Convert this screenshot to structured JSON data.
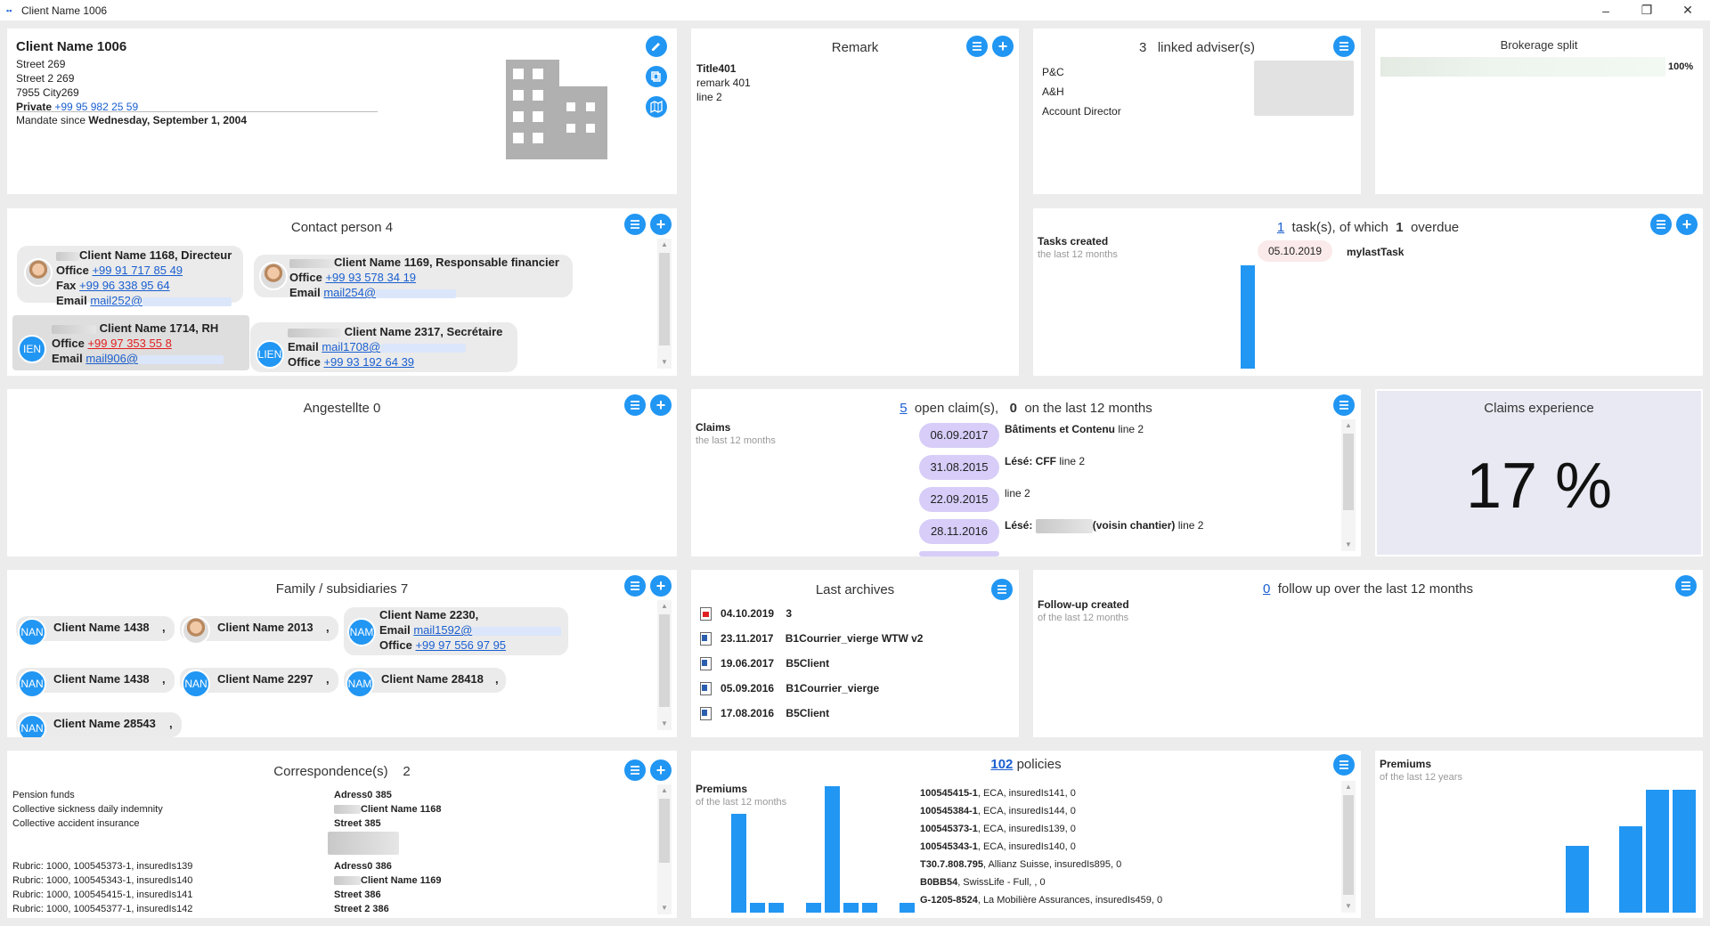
{
  "window": {
    "title": "Client Name 1006",
    "min": "–",
    "max": "❐",
    "close": "✕"
  },
  "client": {
    "name": "Client Name 1006",
    "street": "Street 269",
    "street2": "Street 2 269",
    "city": "7955 City269",
    "phone_label": "Private",
    "phone": "+99 95 982 25 59",
    "mandate_label": "Mandate since",
    "mandate_date": "Wednesday, September 1, 2004"
  },
  "remark": {
    "title": "Remark",
    "heading": "Title401",
    "line1": "remark 401",
    "line2": "line 2"
  },
  "advisers": {
    "count": "3",
    "title": "linked adviser(s)",
    "roles": [
      "P&C",
      "A&H",
      "Account Director"
    ]
  },
  "brokerage": {
    "title": "Brokerage split",
    "percent": "100%",
    "fill": 1.0
  },
  "contacts": {
    "title": "Contact person 4",
    "persons": [
      {
        "name": "Client Name 1168",
        "role": ", Directeur",
        "office_label": "Office",
        "office": "+99 91 717 85 49",
        "fax_label": "Fax",
        "fax": "+99 96 338 95 64",
        "email_label": "Email",
        "email": "mail252@"
      },
      {
        "name": "Client Name 1169",
        "role": ", Responsable financier",
        "office_label": "Office",
        "office": "+99 93 578 34 19",
        "email_label": "Email",
        "email": "mail254@"
      },
      {
        "name": "Client Name 1714",
        "role": ", RH",
        "office_label": "Office",
        "office": "+99 97 353 55 8",
        "email_label": "Email",
        "email": "mail906@",
        "avatar": "IEN"
      },
      {
        "name": "Client Name 2317",
        "role": ", Secrétaire",
        "email_label": "Email",
        "email": "mail1708@",
        "office_label": "Office",
        "office": "+99 93 192 64 39",
        "avatar": "LIEN"
      }
    ]
  },
  "tasks": {
    "count": "1",
    "middle": "task(s), of which",
    "overdue_count": "1",
    "overdue": "overdue",
    "chart_title": "Tasks created",
    "chart_sub": "the last 12 months",
    "date": "05.10.2019",
    "task": "mylastTask"
  },
  "angestellte": {
    "title": "Angestellte 0"
  },
  "claims": {
    "open_count": "5",
    "open_label": "open claim(s),",
    "recent_count": "0",
    "recent_label": "on the last 12 months",
    "chart_title": "Claims",
    "chart_sub": "the last 12 months",
    "items": [
      {
        "date": "06.09.2017",
        "label": "Bâtiments et Contenu",
        "extra": "line 2"
      },
      {
        "date": "31.08.2015",
        "label": "Lésé: CFF",
        "extra": "line 2"
      },
      {
        "date": "22.09.2015",
        "label": "",
        "extra": "line 2"
      },
      {
        "date": "28.11.2016",
        "label": "Lésé:",
        "mid": "(voisin chantier)",
        "extra": "line 2"
      }
    ]
  },
  "claims_experience": {
    "title": "Claims experience",
    "value": "17 %"
  },
  "family": {
    "title": "Family / subsidiaries 7",
    "members": [
      {
        "name": "Client Name 1438",
        "suffix": ",",
        "avatar": "NAN"
      },
      {
        "name": "Client Name 2013",
        "suffix": ",",
        "avatar": "photo"
      },
      {
        "name": "Client Name 2230",
        "suffix": ",",
        "avatar": "NAM",
        "email_label": "Email",
        "email": "mail1592@",
        "office_label": "Office",
        "office": "+99 97 556 97 95"
      },
      {
        "name": "Client Name 1438",
        "suffix": ",",
        "avatar": "NAN"
      },
      {
        "name": "Client Name 2297",
        "suffix": ",",
        "avatar": "NAN"
      },
      {
        "name": "Client Name 28418",
        "suffix": ",",
        "avatar": "NAM"
      },
      {
        "name": "Client Name 28543",
        "suffix": ",",
        "avatar": "NAN"
      }
    ]
  },
  "archives": {
    "title": "Last archives",
    "items": [
      {
        "icon": "pdf-icon",
        "date": "04.10.2019",
        "name": "3"
      },
      {
        "icon": "word-icon",
        "date": "23.11.2017",
        "name": "B1Courrier_vierge WTW v2"
      },
      {
        "icon": "word-icon",
        "date": "19.06.2017",
        "name": "B5Client"
      },
      {
        "icon": "word-icon",
        "date": "05.09.2016",
        "name": "B1Courrier_vierge"
      },
      {
        "icon": "word-icon",
        "date": "17.08.2016",
        "name": "B5Client"
      }
    ]
  },
  "followup": {
    "count": "0",
    "label": "follow up over the last 12 months",
    "chart_title": "Follow-up created",
    "chart_sub": "of the last 12 months"
  },
  "correspondence": {
    "title": "Correspondence(s)",
    "count": "2",
    "left1": [
      "Pension funds",
      "Collective sickness daily indemnity",
      "Collective accident insurance"
    ],
    "left2": [
      "Rubric: 1000, 100545373-1, insuredIs139",
      "Rubric: 1000, 100545343-1, insuredIs140",
      "Rubric: 1000, 100545415-1, insuredIs141",
      "Rubric: 1000, 100545377-1, insuredIs142"
    ],
    "right1": [
      "Adress0 385",
      "Client Name 1168",
      "Street 385"
    ],
    "right2": [
      "Adress0 386",
      "Client Name 1169",
      "Street 386",
      "Street 2 386"
    ]
  },
  "policies": {
    "count": "102",
    "label": "policies",
    "chart_title": "Premiums",
    "chart_sub": "of the last 12 months",
    "items": [
      {
        "id": "100545415-1",
        "rest": ", ECA, insuredIs141,  0"
      },
      {
        "id": "100545384-1",
        "rest": ", ECA, insuredIs144,  0"
      },
      {
        "id": "100545373-1",
        "rest": ", ECA, insuredIs139,  0"
      },
      {
        "id": "100545343-1",
        "rest": ", ECA, insuredIs140,  0"
      },
      {
        "id": "T30.7.808.795",
        "rest": ", Allianz Suisse, insuredIs895,  0"
      },
      {
        "id": "B0BB54",
        "rest": ", SwissLife - Full, ,  0"
      },
      {
        "id": "G-1205-8524",
        "rest": ", La Mobilière Assurances, insuredIs459,  0"
      }
    ]
  },
  "premiums": {
    "title": "Premiums",
    "sub": "of the last 12 years"
  },
  "chart_data": [
    {
      "type": "bar",
      "title": "Tasks created",
      "values": [
        1
      ]
    },
    {
      "type": "bar",
      "title": "Premiums",
      "subtitle": "of the last 12 months",
      "values": [
        0.78,
        0.08,
        0.08,
        0,
        0.08,
        1.0,
        0.08,
        0.08,
        0,
        0.08
      ]
    },
    {
      "type": "bar",
      "title": "Premiums",
      "subtitle": "of the last 12 years",
      "values": [
        0.54,
        0,
        0.7,
        1.0,
        1.0
      ]
    }
  ],
  "colors": {
    "accent": "#2196f3",
    "claim_pill": "#d7cdf8",
    "date_pill": "#fbeaea",
    "experience_bg": "#e9e9f3"
  }
}
